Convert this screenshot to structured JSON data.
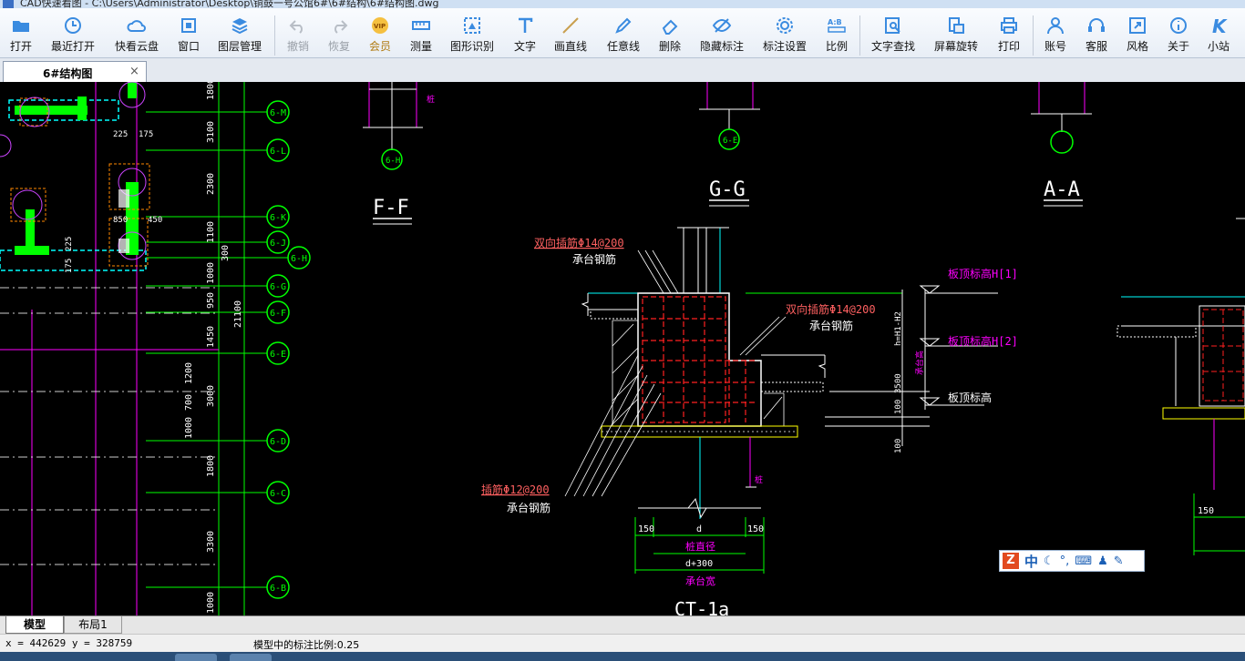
{
  "window": {
    "title": "CAD快速看图 - C:\\Users\\Administrator\\Desktop\\铜鼓一号公馆6#\\6#结构\\6#结构图.dwg"
  },
  "toolbar": {
    "open": "打开",
    "recent": "最近打开",
    "cloud": "快看云盘",
    "window": "窗口",
    "layers": "图层管理",
    "undo": "撤销",
    "redo": "恢复",
    "vip": "会员",
    "measure": "测量",
    "recognize": "图形识别",
    "text": "文字",
    "line": "画直线",
    "freeline": "任意线",
    "delete": "删除",
    "hide_dim": "隐藏标注",
    "dim_settings": "标注设置",
    "scale": "比例",
    "text_search": "文字查找",
    "rotate": "屏幕旋转",
    "print": "打印",
    "account": "账号",
    "service": "客服",
    "style": "风格",
    "about": "关于",
    "site": "小站"
  },
  "doc_tab": {
    "name": "6#结构图",
    "close": "×"
  },
  "drawing": {
    "axes": [
      "6-M",
      "6-L",
      "6-K",
      "6-J",
      "6-H",
      "6-G",
      "6-F",
      "6-E",
      "6-D",
      "6-C",
      "6-B"
    ],
    "dims_vertical": [
      "1800",
      "3100",
      "2300",
      "1100",
      "300",
      "1000",
      "950",
      "1450",
      "3000",
      "1800",
      "3300",
      "1000",
      "21100",
      "1200",
      "700",
      "1000"
    ],
    "plan_dims": [
      "225",
      "175",
      "850",
      "450",
      "225",
      "175"
    ],
    "sections": [
      "F-F",
      "G-G",
      "A-A"
    ],
    "section_axis_labels": [
      "6-H",
      "6-E"
    ],
    "bar_label_1": "双向插筋Φ14@200",
    "bar_label_1b": "承台钢筋",
    "bar_label_2": "双向插筋Φ14@200",
    "bar_label_2b": "承台钢筋",
    "bar_label_3": "插筋Φ12@200",
    "bar_label_3b": "承台钢筋",
    "elev_1": "板顶标高H[1]",
    "elev_2": "板顶标高H[2]",
    "elev_3": "板顶标高",
    "right_dims": [
      "h=H1-H2",
      "承台高",
      "3500",
      "100",
      "100"
    ],
    "pile_label": "桩",
    "bottom_dims": {
      "left": "150",
      "mid": "d",
      "right": "150",
      "pile_dia": "桩直径",
      "width": "d+300",
      "cap_width": "承台宽"
    },
    "ct_label": "CT-1a",
    "right_dim_150": "150"
  },
  "layout_tabs": {
    "model": "模型",
    "layout1": "布局1"
  },
  "status": {
    "coords": "x = 442629  y = 328759",
    "scale_text": "模型中的标注比例:0.25"
  },
  "ime": {
    "mode": "中"
  },
  "colors": {
    "bg": "#000000",
    "axis": "#00ff00",
    "magenta": "#ff00ff",
    "cyan": "#00ffff",
    "red": "#ff2020",
    "yellow": "#ffff00",
    "white": "#ffffff"
  }
}
